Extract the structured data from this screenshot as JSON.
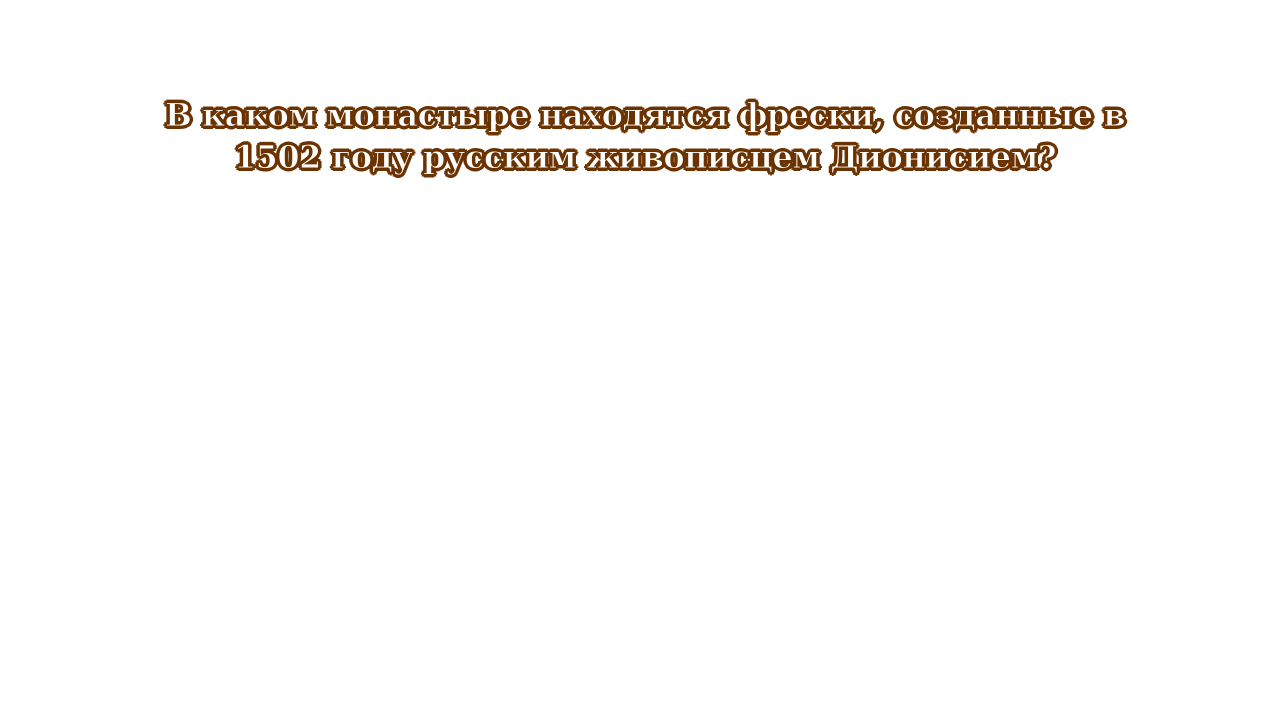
{
  "slide": {
    "question": "В каком монастыре находятся фрески, созданные в 1502 году русским живописцем Дионисием?",
    "text_color": "#ffffff",
    "outline_color": "#6b3300",
    "background_color": "#ffffff"
  }
}
